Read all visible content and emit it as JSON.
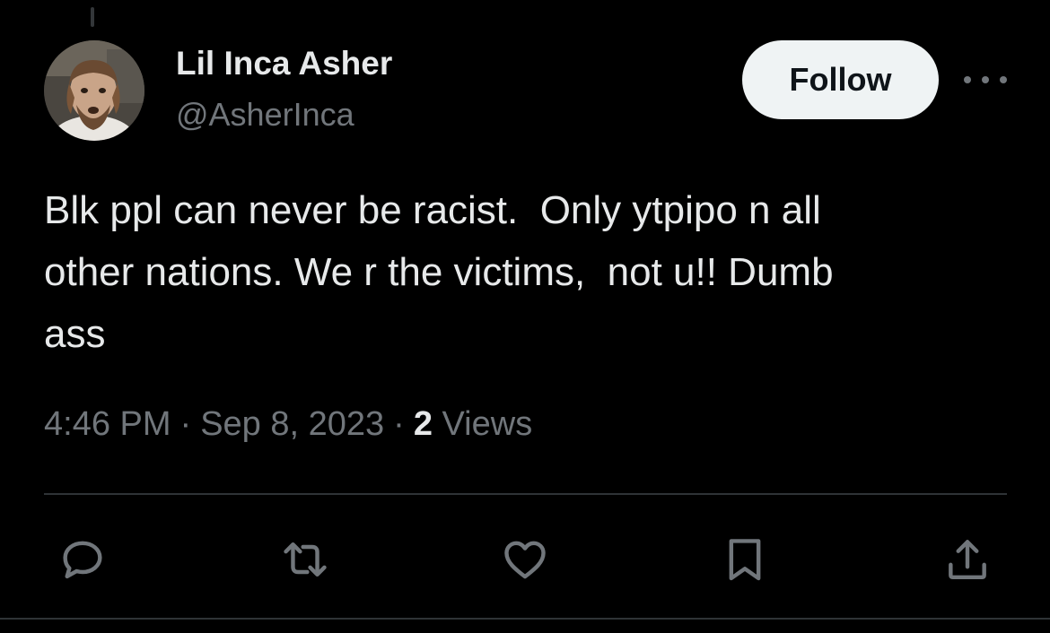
{
  "tweet": {
    "author": {
      "display_name": "Lil Inca Asher",
      "handle": "@AsherInca",
      "avatar_icon": "user-avatar"
    },
    "follow_label": "Follow",
    "more_icon": "more-horizontal-icon",
    "text": "Blk ppl can never be racist.  Only ytpipo n all\nother nations. We r the victims,  not u!! Dumb\nass",
    "time": "4:46 PM",
    "separator": "·",
    "date": "Sep 8, 2023",
    "views_count": "2",
    "views_label": "Views"
  },
  "actions": [
    {
      "name": "reply",
      "icon": "reply-icon"
    },
    {
      "name": "repost",
      "icon": "repost-icon"
    },
    {
      "name": "like",
      "icon": "like-icon"
    },
    {
      "name": "bookmark",
      "icon": "bookmark-icon"
    },
    {
      "name": "share",
      "icon": "share-icon"
    }
  ],
  "colors": {
    "background": "#000000",
    "primary_text": "#e7e9ea",
    "secondary_text": "#71767b",
    "divider": "#2f3336",
    "follow_button_bg": "#eff3f4",
    "follow_button_text": "#0f1419"
  }
}
